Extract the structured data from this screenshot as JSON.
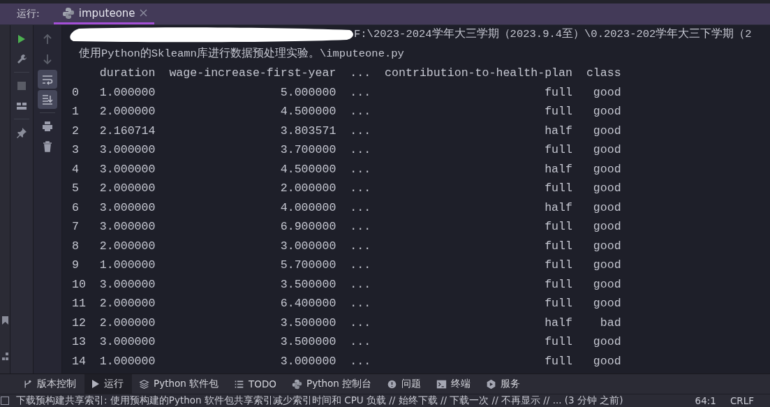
{
  "run_panel": {
    "label": "运行:",
    "tabs": [
      {
        "label": "imputeone",
        "selected": true
      }
    ]
  },
  "toolbar": {
    "primary": [
      {
        "kind": "run"
      },
      {
        "kind": "wrench"
      },
      {
        "kind": "stop"
      },
      {
        "kind": "layout"
      },
      {
        "kind": "pin"
      }
    ],
    "secondary": [
      {
        "kind": "up",
        "on": false
      },
      {
        "kind": "down",
        "on": false
      },
      {
        "kind": "wrap",
        "on": true
      },
      {
        "kind": "scroll-end",
        "on": true
      },
      {
        "kind": "print",
        "on": false
      },
      {
        "kind": "trash",
        "on": false
      }
    ]
  },
  "console": {
    "path_line": "F:\\2023-2024学年大三学期（2023.9.4至）\\0.2023-202学年大三下学期（2",
    "script_line": "使用Python的Skleamn库进行数据预处理实验。\\imputeone.py",
    "columns": [
      "",
      "duration",
      "wage-increase-first-year",
      "...",
      "contribution-to-health-plan",
      "class"
    ],
    "rows": [
      [
        "0",
        "1.000000",
        "5.000000",
        "...",
        "full",
        "good"
      ],
      [
        "1",
        "2.000000",
        "4.500000",
        "...",
        "full",
        "good"
      ],
      [
        "2",
        "2.160714",
        "3.803571",
        "...",
        "half",
        "good"
      ],
      [
        "3",
        "3.000000",
        "3.700000",
        "...",
        "full",
        "good"
      ],
      [
        "4",
        "3.000000",
        "4.500000",
        "...",
        "half",
        "good"
      ],
      [
        "5",
        "2.000000",
        "2.000000",
        "...",
        "full",
        "good"
      ],
      [
        "6",
        "3.000000",
        "4.000000",
        "...",
        "half",
        "good"
      ],
      [
        "7",
        "3.000000",
        "6.900000",
        "...",
        "full",
        "good"
      ],
      [
        "8",
        "2.000000",
        "3.000000",
        "...",
        "full",
        "good"
      ],
      [
        "9",
        "1.000000",
        "5.700000",
        "...",
        "full",
        "good"
      ],
      [
        "10",
        "3.000000",
        "3.500000",
        "...",
        "full",
        "good"
      ],
      [
        "11",
        "2.000000",
        "6.400000",
        "...",
        "full",
        "good"
      ],
      [
        "12",
        "2.000000",
        "3.500000",
        "...",
        "half",
        "bad"
      ],
      [
        "13",
        "3.000000",
        "3.500000",
        "...",
        "full",
        "good"
      ],
      [
        "14",
        "1.000000",
        "3.000000",
        "...",
        "full",
        "good"
      ]
    ]
  },
  "tool_windows": [
    {
      "label": "版本控制",
      "kind": "vcs",
      "selected": false
    },
    {
      "label": "运行",
      "kind": "run",
      "selected": true
    },
    {
      "label": "Python 软件包",
      "kind": "packages",
      "selected": false
    },
    {
      "label": "TODO",
      "kind": "todo",
      "selected": false
    },
    {
      "label": "Python 控制台",
      "kind": "python",
      "selected": false
    },
    {
      "label": "问题",
      "kind": "problems",
      "selected": false
    },
    {
      "label": "终端",
      "kind": "terminal",
      "selected": false
    },
    {
      "label": "服务",
      "kind": "services",
      "selected": false
    }
  ],
  "status_bar": {
    "message": "下载预构建共享索引: 使用预构建的Python 软件包共享索引减少索引时间和 CPU 负载 // 始终下载 // 下载一次 // 不再显示 // ... (3 分钟 之前)",
    "position": "64:1",
    "line_ending": "CRLF"
  }
}
